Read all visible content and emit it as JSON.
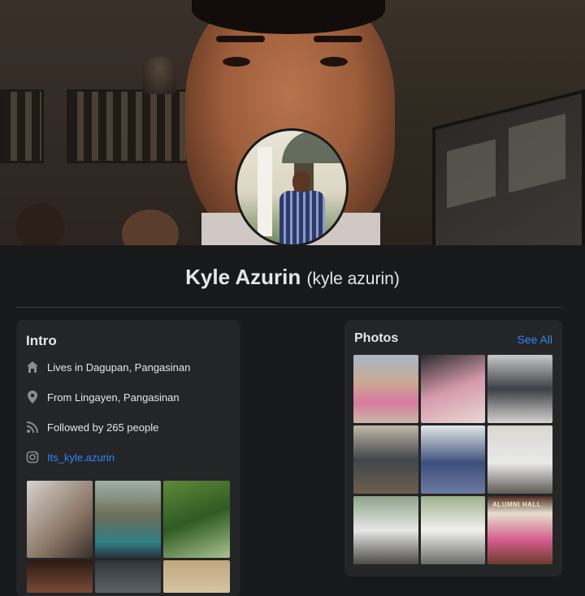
{
  "profile": {
    "name": "Kyle Azurin",
    "alternate_name": "(kyle azurin)"
  },
  "intro": {
    "title": "Intro",
    "items": [
      {
        "icon": "home-icon",
        "text": "Lives in Dagupan, Pangasinan"
      },
      {
        "icon": "location-pin-icon",
        "text": "From Lingayen, Pangasinan"
      },
      {
        "icon": "rss-icon",
        "text": "Followed by 265 people"
      },
      {
        "icon": "instagram-icon",
        "text": "Its_kyle.azurin"
      }
    ]
  },
  "photos": {
    "title": "Photos",
    "see_all": "See All",
    "tile_9_caption": "ALUMNI HALL"
  },
  "colors": {
    "background": "#18191a",
    "card": "#242526",
    "text": "#e4e6eb",
    "link": "#2d88ff"
  }
}
